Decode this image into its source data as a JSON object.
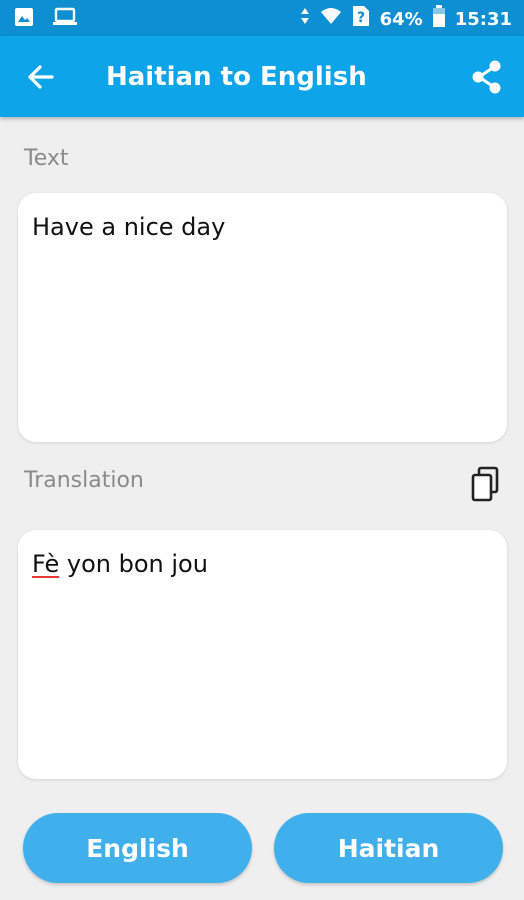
{
  "status_bar": {
    "battery": "64%",
    "time": "15:31"
  },
  "app_bar": {
    "title": "Haitian to English"
  },
  "text_section": {
    "label": "Text",
    "value": "Have a nice day"
  },
  "translation_section": {
    "label": "Translation",
    "value_word1": "Fè",
    "value_rest": " yon bon jou"
  },
  "buttons": {
    "left": "English",
    "right": "Haitian"
  },
  "colors": {
    "status_bar": "#0d8fd2",
    "app_bar": "#0ea4e9",
    "pill": "#3fb0ec"
  }
}
